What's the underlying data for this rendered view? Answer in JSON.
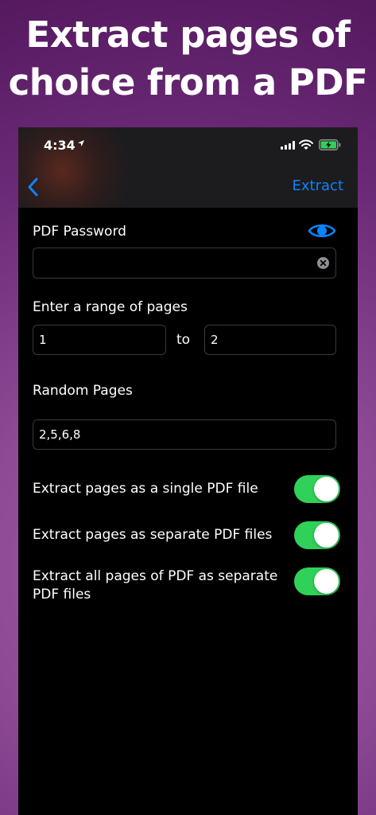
{
  "headline": {
    "line1": "Extract pages of",
    "line2": "choice from a PDF"
  },
  "status_bar": {
    "time": "4:34"
  },
  "nav": {
    "back_icon": "chevron-left-icon",
    "extract_label": "Extract"
  },
  "form": {
    "password_label": "PDF Password",
    "password_value": "",
    "range_label": "Enter a range of pages",
    "range_from": "1",
    "range_separator": "to",
    "range_to": "2",
    "random_label": "Random Pages",
    "random_value": "2,5,6,8"
  },
  "toggles": [
    {
      "label": "Extract pages as a single PDF file",
      "on": true
    },
    {
      "label": "Extract pages as separate PDF files",
      "on": true
    },
    {
      "label": "Extract all pages of PDF as separate PDF files",
      "on": true
    }
  ],
  "colors": {
    "accent": "#0a84ff",
    "toggle_on": "#30d158",
    "background": "#000000",
    "navbar": "#1c1c1e"
  }
}
